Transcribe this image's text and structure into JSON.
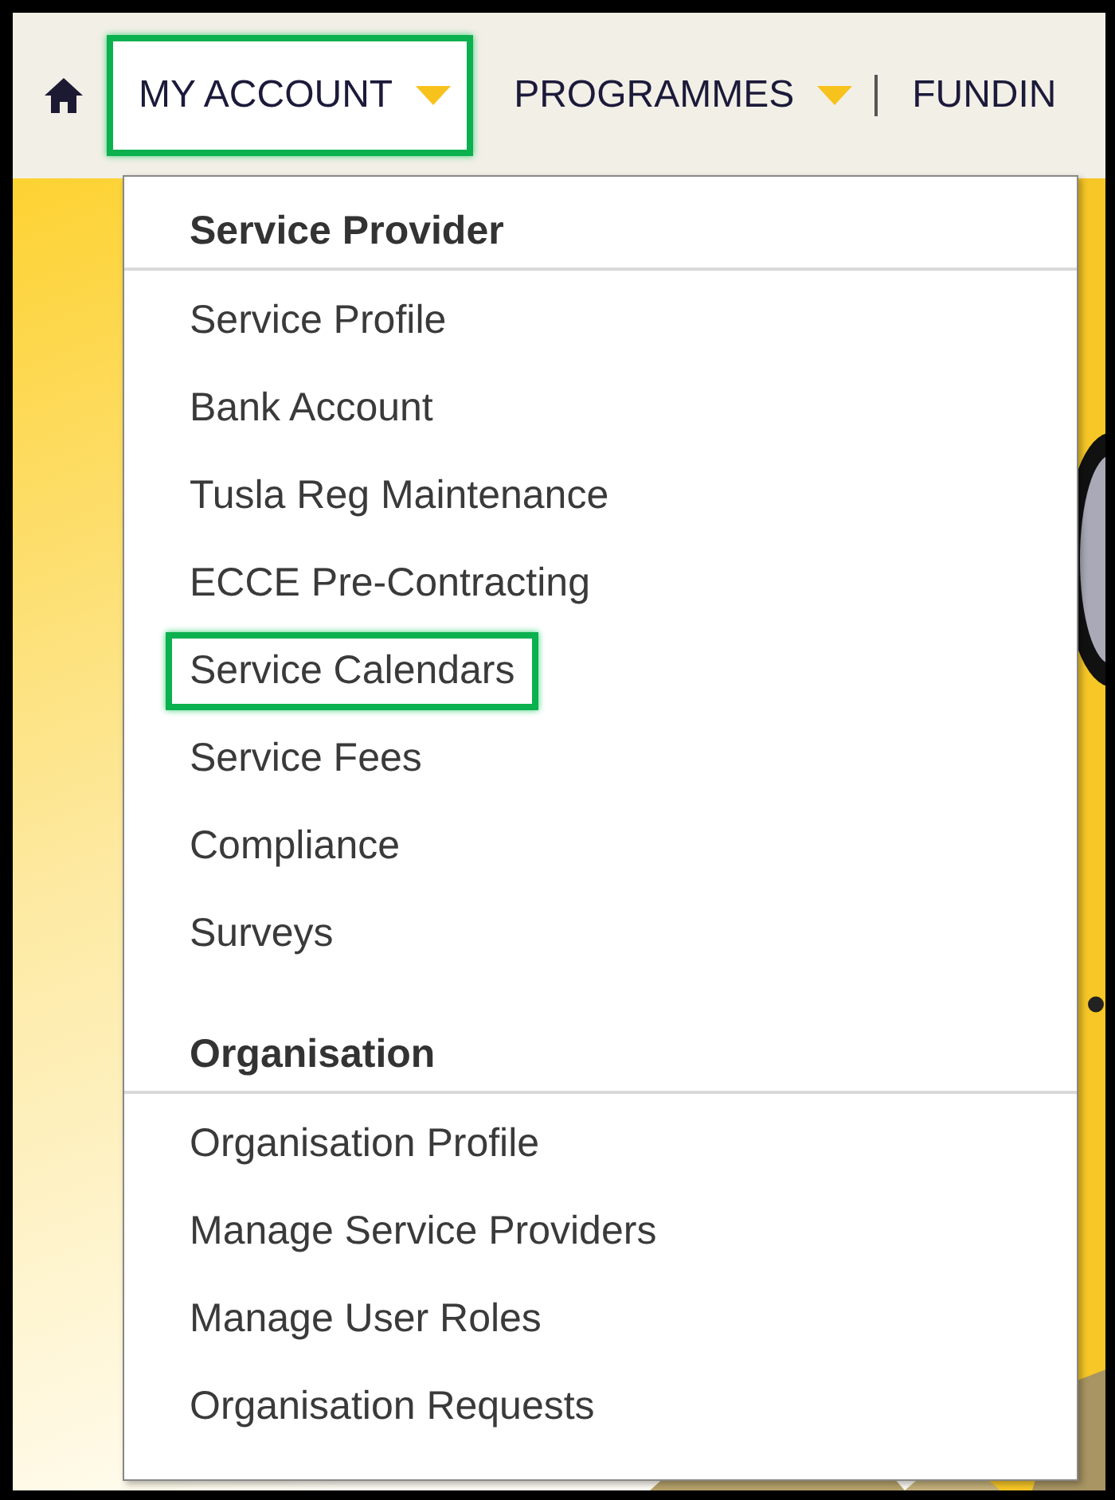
{
  "nav": {
    "items": [
      {
        "label": "MY ACCOUNT",
        "dropdown": true,
        "highlighted": true
      },
      {
        "label": "PROGRAMMES",
        "dropdown": true,
        "highlighted": false
      },
      {
        "label": "FUNDIN",
        "dropdown": false,
        "highlighted": false
      }
    ]
  },
  "menu": {
    "sections": [
      {
        "heading": "Service Provider",
        "items": [
          {
            "label": "Service Profile",
            "highlighted": false
          },
          {
            "label": "Bank Account",
            "highlighted": false
          },
          {
            "label": "Tusla Reg Maintenance",
            "highlighted": false
          },
          {
            "label": "ECCE Pre-Contracting",
            "highlighted": false
          },
          {
            "label": "Service Calendars",
            "highlighted": true
          },
          {
            "label": "Service Fees",
            "highlighted": false
          },
          {
            "label": "Compliance",
            "highlighted": false
          },
          {
            "label": "Surveys",
            "highlighted": false
          }
        ]
      },
      {
        "heading": "Organisation",
        "items": [
          {
            "label": "Organisation Profile",
            "highlighted": false
          },
          {
            "label": "Manage Service Providers",
            "highlighted": false
          },
          {
            "label": "Manage User Roles",
            "highlighted": false
          },
          {
            "label": "Organisation Requests",
            "highlighted": false
          }
        ]
      }
    ]
  }
}
